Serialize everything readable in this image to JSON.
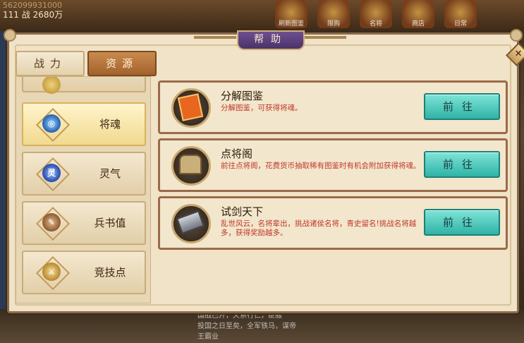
{
  "hud": {
    "row1": "562099931000",
    "level": "111",
    "power_label": "战",
    "power_value": "2680万",
    "icons": [
      {
        "name": "recharge-icon",
        "label": "刷新图鉴"
      },
      {
        "name": "bonus-icon",
        "label": "限购"
      },
      {
        "name": "event-icon",
        "label": "名将"
      },
      {
        "name": "shop-icon",
        "label": "商店"
      },
      {
        "name": "welfare-icon",
        "label": "日常"
      }
    ]
  },
  "chat": {
    "lines": [
      "国战已开，天系行仁，臣服",
      "投国之日至矣，全军铁马，谋帝",
      "王霸业"
    ]
  },
  "dialog": {
    "title": "帮助",
    "close_label": "×",
    "tabs": [
      {
        "label": "战力",
        "active": false
      },
      {
        "label": "资源",
        "active": true
      }
    ],
    "categories": [
      {
        "label": "",
        "icon": "gold-icon",
        "partial": true
      },
      {
        "label": "将魂",
        "icon": "swirl-soul-icon",
        "active": true,
        "color": "#2f7fd0"
      },
      {
        "label": "灵气",
        "icon": "spirit-orb-icon",
        "color": "#3a6fd8",
        "glyph": "灵"
      },
      {
        "label": "兵书值",
        "icon": "scroll-icon",
        "color": "#a06a3a"
      },
      {
        "label": "竞技点",
        "icon": "sword-coin-icon",
        "color": "#c89a3a"
      }
    ],
    "entries": [
      {
        "title": "分解图鉴",
        "desc": "分解图鉴，可获得将魂。",
        "icon": "card-book-icon",
        "button": "前往"
      },
      {
        "title": "点将阁",
        "desc": "前往点将阁，花费货币抽取稀有图鉴时有机会附加获得将魂。",
        "icon": "pavilion-icon",
        "button": "前往"
      },
      {
        "title": "试剑天下",
        "desc": "乱世风云，名将辈出，挑战诸侯名将，青史留名!挑战名将越多，获得奖励越多。",
        "icon": "iron-ingot-icon",
        "button": "前往"
      }
    ]
  },
  "colors": {
    "accent_button": "#2fb3a6",
    "desc_text": "#c0392b",
    "active_tab": "#a3622c"
  }
}
